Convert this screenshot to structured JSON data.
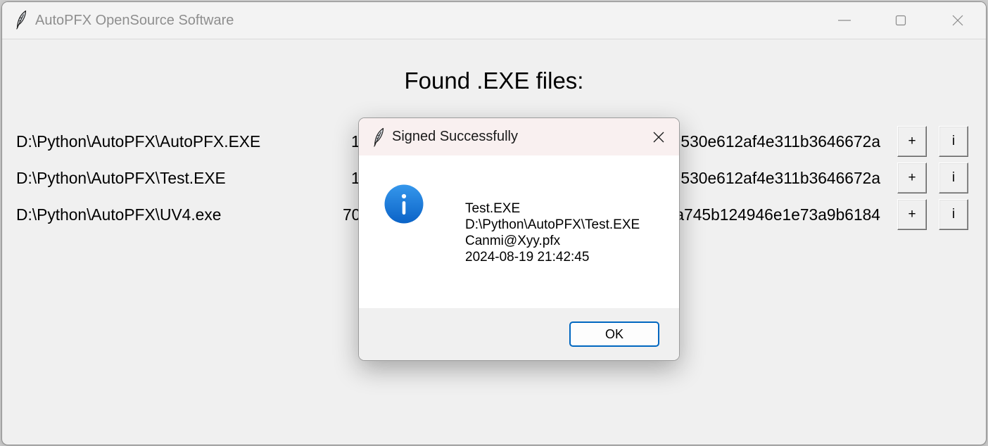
{
  "window": {
    "title": "AutoPFX OpenSource Software",
    "icon": "feather-icon",
    "controls": [
      "minimize-icon",
      "maximize-icon",
      "close-icon"
    ]
  },
  "main": {
    "heading": "Found .EXE files:",
    "files": [
      {
        "path": "D:\\Python\\AutoPFX\\AutoPFX.EXE",
        "col2": "1",
        "hash": "d530e612af4e311b3646672a",
        "add_button": "+",
        "info_button": "i"
      },
      {
        "path": "D:\\Python\\AutoPFX\\Test.EXE",
        "col2": "1",
        "hash": "d530e612af4e311b3646672a",
        "add_button": "+",
        "info_button": "i"
      },
      {
        "path": "D:\\Python\\AutoPFX\\UV4.exe",
        "col2": "70",
        "hash": "3a745b124946e1e73a9b6184",
        "add_button": "+",
        "info_button": "i"
      }
    ]
  },
  "dialog": {
    "title": "Signed Successfully",
    "icon": "feather-icon",
    "message_icon": "info-icon",
    "close_icon": "close-icon",
    "message_lines": [
      "Test.EXE",
      "D:\\Python\\AutoPFX\\Test.EXE",
      "Canmi@Xyy.pfx",
      "2024-08-19 21:42:45"
    ],
    "ok_label": "OK"
  },
  "colors": {
    "window_bg": "#f0f0f0",
    "titlebar_bg": "#f3f3f3",
    "dialog_titlebar": "#f9f0f0",
    "accent": "#0067c0",
    "inactive_text": "#8e8e8e",
    "info_blue_top": "#3597ec",
    "info_blue_bottom": "#0b63c7"
  }
}
